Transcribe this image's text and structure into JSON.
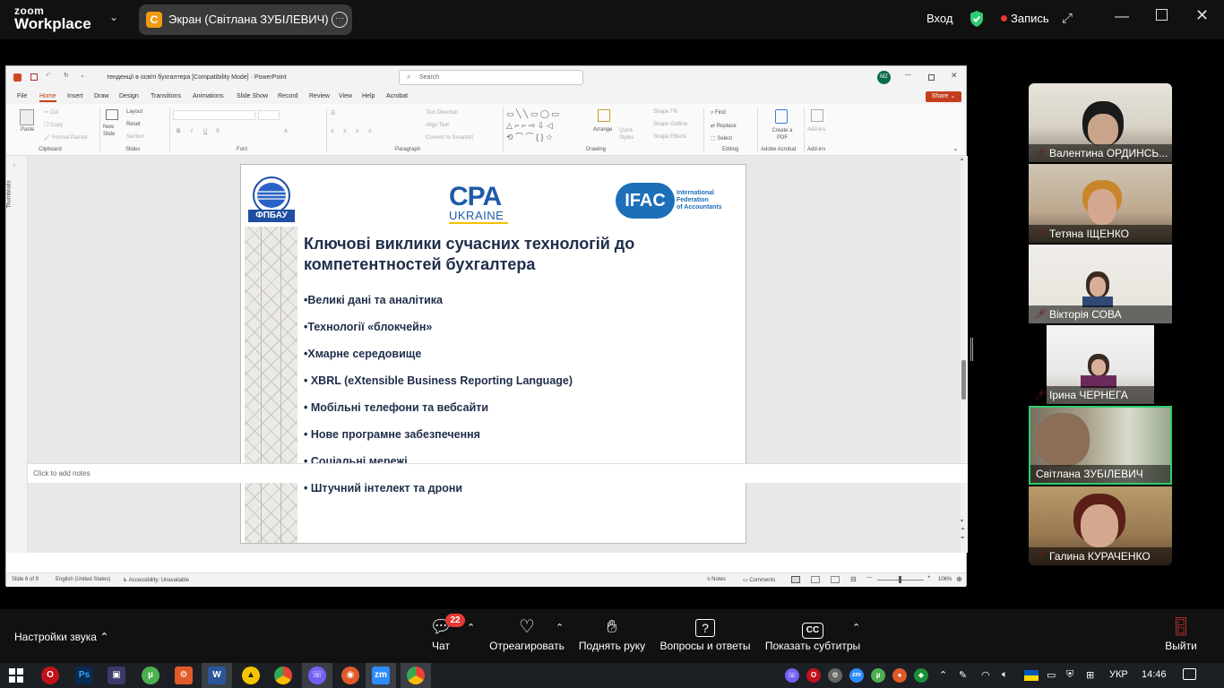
{
  "zoom": {
    "brand_top": "zoom",
    "brand_bottom": "Workplace",
    "share_avatar_letter": "С",
    "share_label": "Экран (Світлана ЗУБІЛЕВИЧ)",
    "login_label": "Вход",
    "recording_label": "Запись",
    "accent_green": "#2ecc71",
    "record_red": "#e53935"
  },
  "ppt": {
    "title": "тенденції в освіті бухгалтера [Compatibility Mode]  ·  PowerPoint",
    "search_placeholder": "Search",
    "user_initials": "MZ",
    "share_button": "Share",
    "tabs": [
      "File",
      "Home",
      "Insert",
      "Draw",
      "Design",
      "Transitions",
      "Animations",
      "Slide Show",
      "Record",
      "Review",
      "View",
      "Help",
      "Acrobat"
    ],
    "ribbon": {
      "paste": "Paste",
      "cut": "Cut",
      "copy": "Copy",
      "format_painter": "Format Painter",
      "new_slide": "New Slide",
      "layout": "Layout",
      "reset": "Reset",
      "section": "Section",
      "text_direction": "Text Direction",
      "align_text": "Align Text",
      "convert_smartart": "Convert to SmartArt",
      "arrange": "Arrange",
      "quick_styles": "Quick Styles",
      "shape_fill": "Shape Fill",
      "shape_outline": "Shape Outline",
      "shape_effects": "Shape Effects",
      "find": "Find",
      "replace": "Replace",
      "select": "Select",
      "create_pdf": "Create a PDF",
      "add_ins": "Add-ins",
      "groups": {
        "clipboard": "Clipboard",
        "slides": "Slides",
        "font": "Font",
        "paragraph": "Paragraph",
        "drawing": "Drawing",
        "editing": "Editing",
        "adobe": "Adobe Acrobat",
        "addins": "Add-ins"
      }
    },
    "thumbnails_label": "Thumbnails",
    "notes_placeholder": "Click to add notes",
    "status": {
      "slide": "Slide 6 of 9",
      "language": "English (United States)",
      "accessibility": "Accessibility: Unavailable",
      "notes": "Notes",
      "comments": "Comments",
      "zoom": "106%"
    }
  },
  "slide": {
    "logo_left_text": "ФПБАУ",
    "logo_cpa_top": "CPA",
    "logo_cpa_bottom": "UKRAINE",
    "logo_ifac": "IFAC",
    "logo_ifac_sub1": "International",
    "logo_ifac_sub2": "Federation",
    "logo_ifac_sub3": "of Accountants",
    "title_line1": "Ключові виклики сучасних технологій до",
    "title_line2": "компетентностей бухгалтера",
    "bullets": [
      "•Великі дані та аналітика",
      "•Технології «блокчейн»",
      "•Хмарне середовище",
      "• XBRL (eXtensible Business Reporting Language)",
      "• Мобільні телефони та вебсайти",
      "• Нове програмне забезпечення",
      "• Соціальні мережі",
      "• Штучний інтелект та дрони"
    ]
  },
  "participants": [
    {
      "name": "Валентина ОРДИНСЬ...",
      "muted": true,
      "active": false
    },
    {
      "name": "Тетяна ІЩЕНКО",
      "muted": true,
      "active": false
    },
    {
      "name": "Вікторія СОВА",
      "muted": true,
      "active": false
    },
    {
      "name": "Ірина ЧЕРНЕГА",
      "muted": true,
      "active": false
    },
    {
      "name": "Світлана ЗУБІЛЕВИЧ",
      "muted": false,
      "active": true
    },
    {
      "name": "Галина КУРАЧЕНКО",
      "muted": true,
      "active": false
    }
  ],
  "controls": {
    "audio_settings": "Настройки звука",
    "chat": "Чат",
    "chat_badge": "22",
    "react": "Отреагировать",
    "raise_hand": "Поднять руку",
    "qa": "Вопросы и ответы",
    "captions": "Показать субтитры",
    "leave": "Выйти"
  },
  "taskbar": {
    "tray_lang": "УКР",
    "time": "14:46"
  }
}
